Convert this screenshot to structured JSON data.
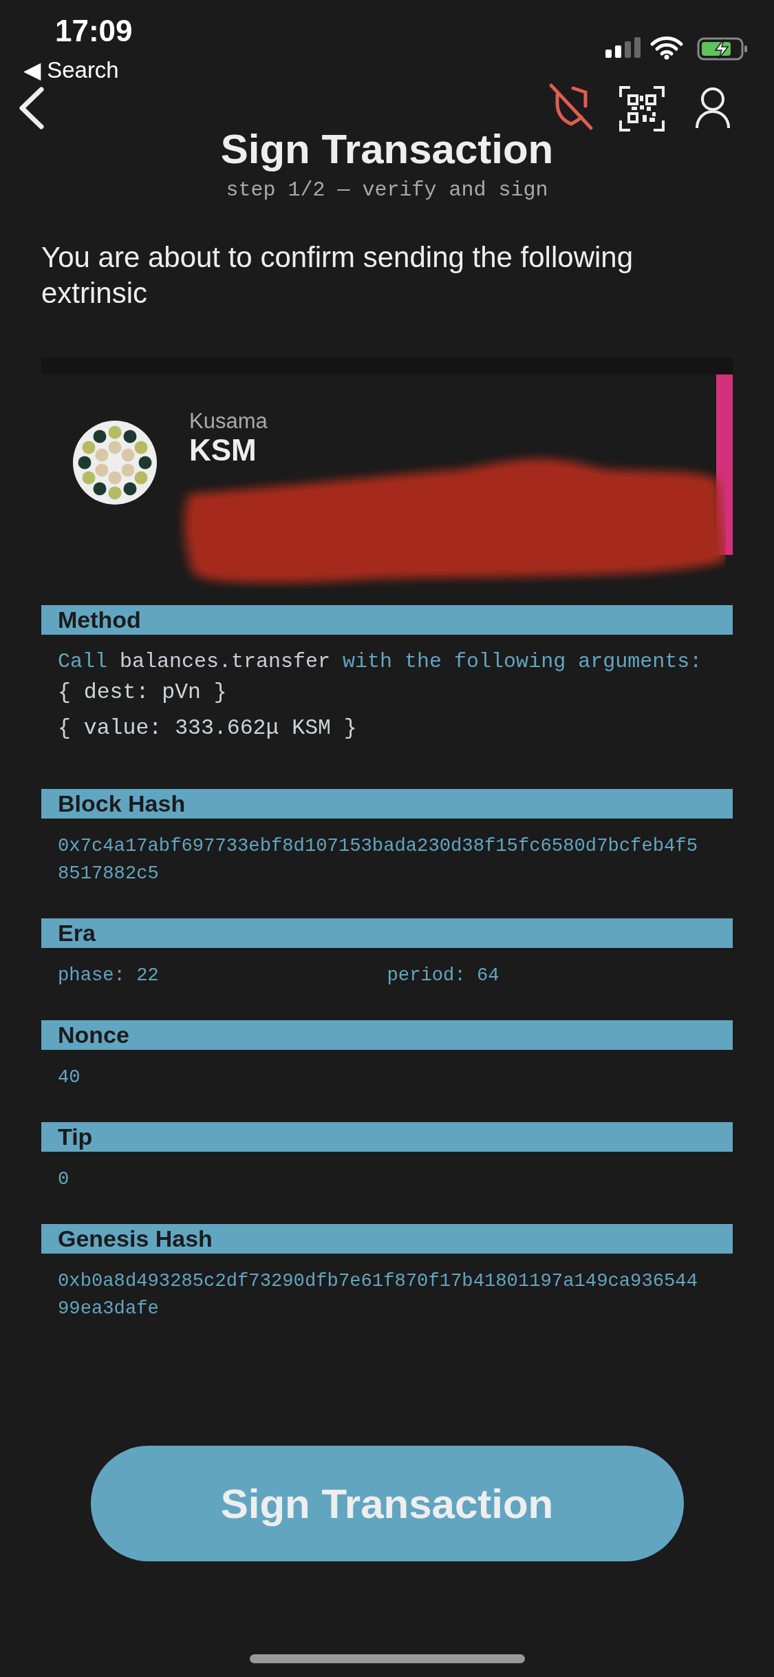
{
  "status_bar": {
    "time": "17:09",
    "back_label": "◀ Search"
  },
  "header": {
    "title": "Sign Transaction",
    "subtitle": "step 1/2 — verify and sign"
  },
  "intro": "You are about to confirm sending the following extrinsic",
  "account": {
    "network": "Kusama",
    "unit": "KSM"
  },
  "sections": [
    {
      "kind": "method",
      "title": "Method",
      "prefix": "Call",
      "call": "balances.transfer",
      "suffix": "with the following arguments:",
      "args": [
        "{ dest: pVn }",
        "{ value: 333.662μ KSM }"
      ]
    },
    {
      "kind": "text",
      "title": "Block Hash",
      "value": "0x7c4a17abf697733ebf8d107153bada230d38f15fc6580d7bcfeb4f58517882c5"
    },
    {
      "kind": "pair",
      "title": "Era",
      "items": [
        "phase: 22",
        "period: 64"
      ]
    },
    {
      "kind": "text",
      "title": "Nonce",
      "value": "40"
    },
    {
      "kind": "text",
      "title": "Tip",
      "value": "0"
    },
    {
      "kind": "text",
      "title": "Genesis Hash",
      "value": "0xb0a8d493285c2df73290dfb7e61f870f17b41801197a149ca93654499ea3dafe"
    }
  ],
  "button": "Sign Transaction"
}
